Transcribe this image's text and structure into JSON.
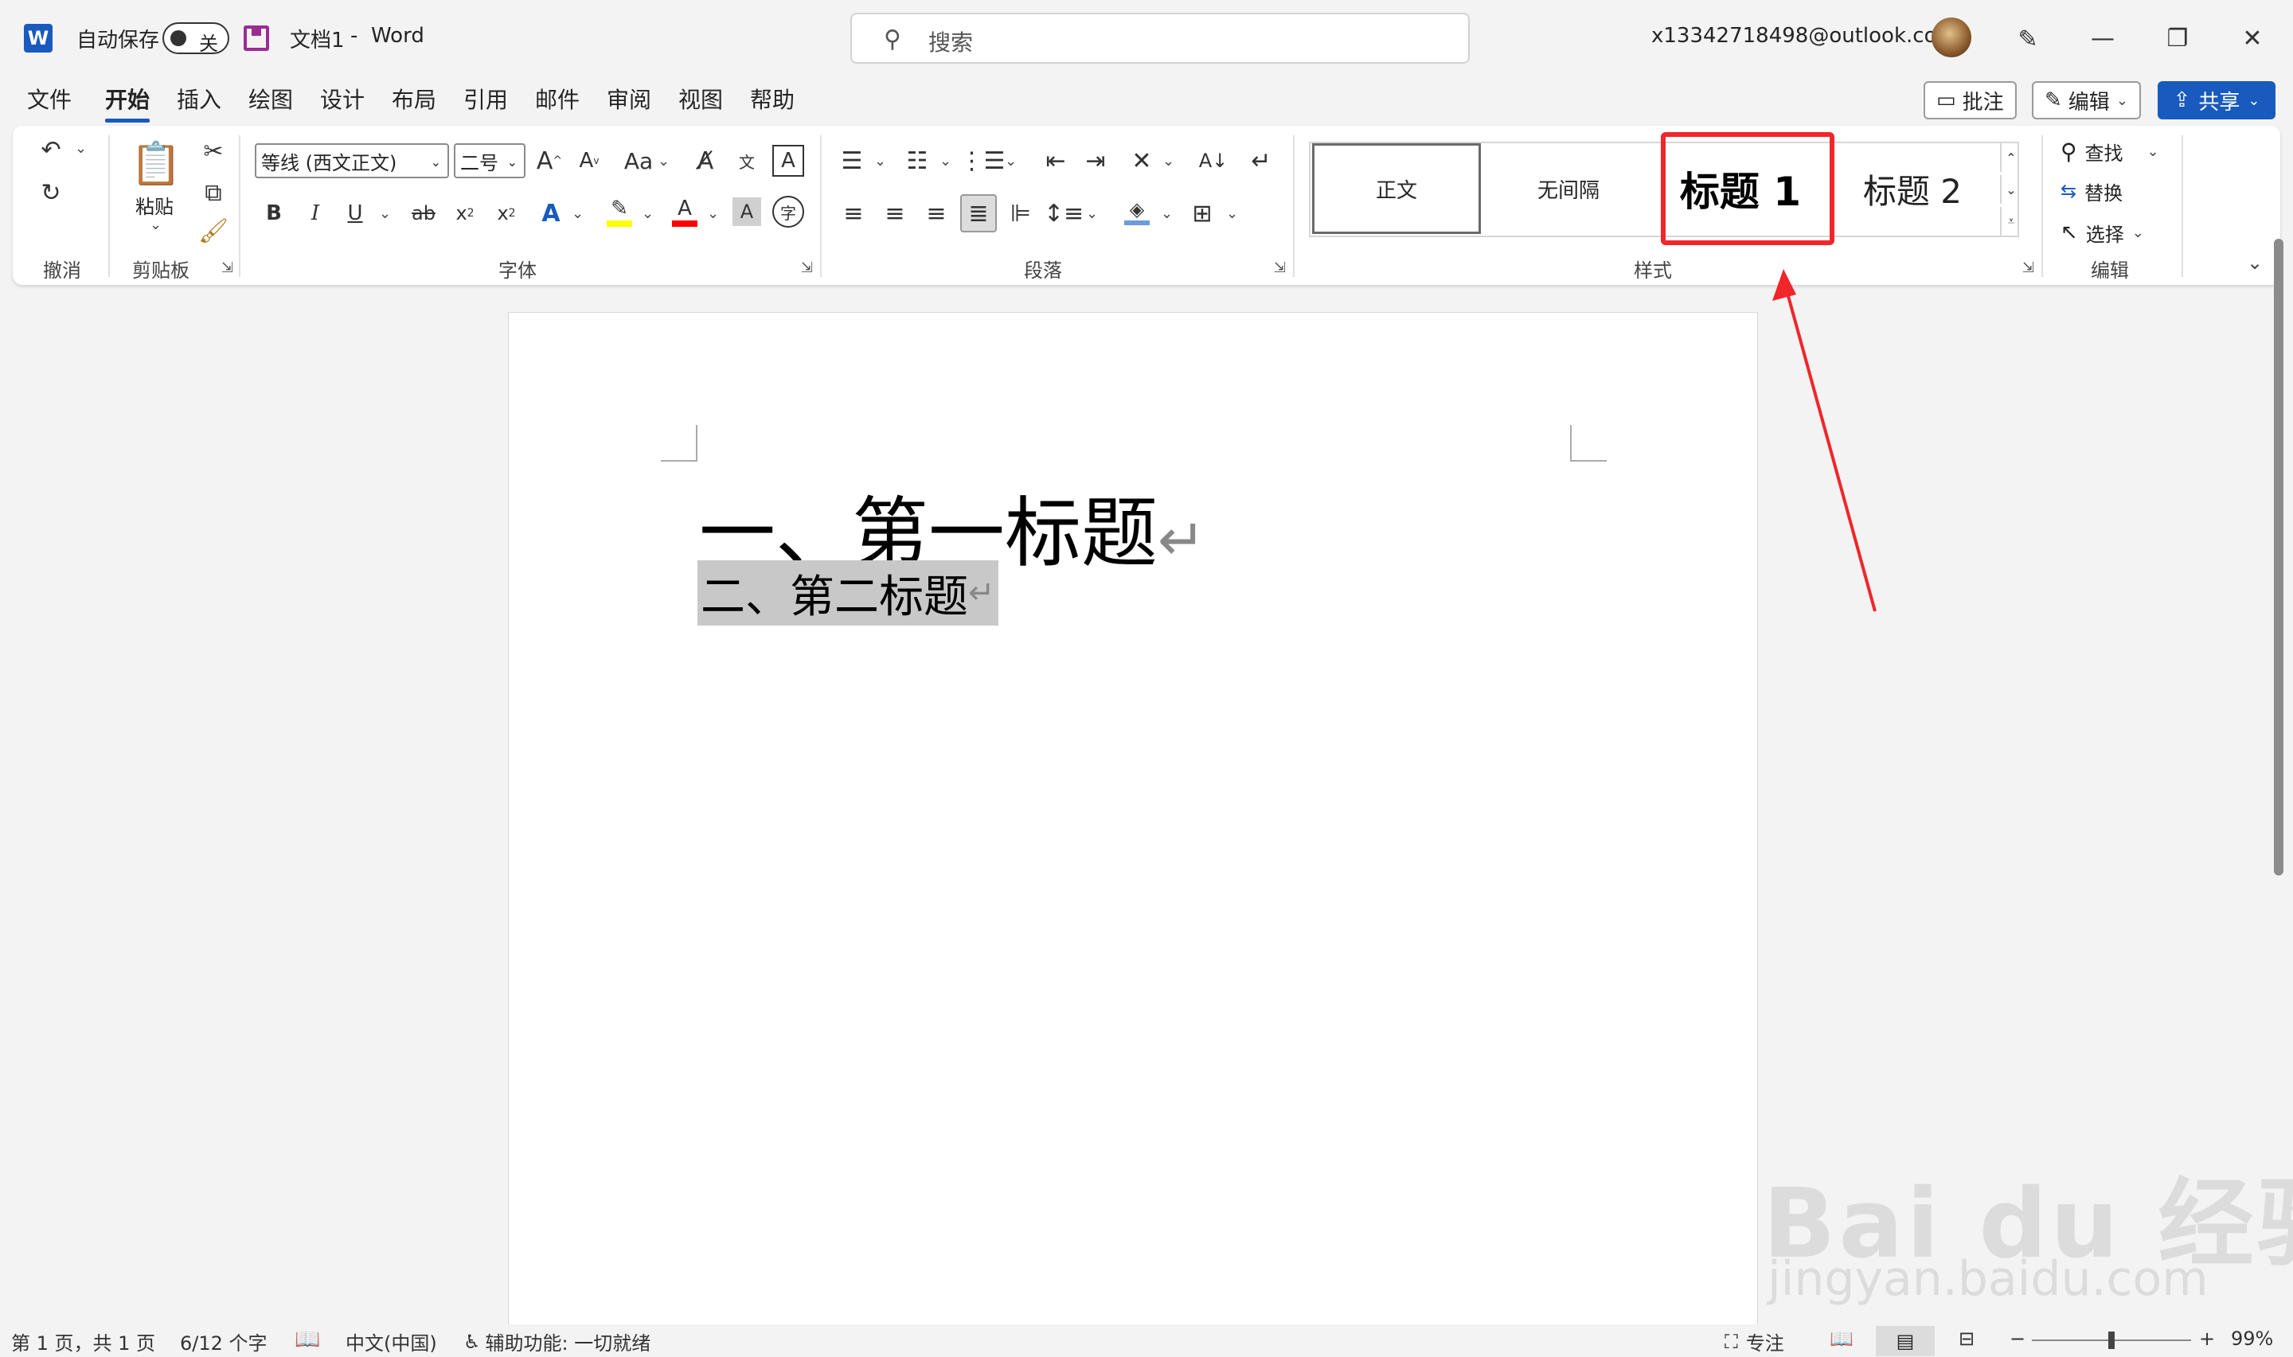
{
  "titlebar": {
    "autosave_label": "自动保存",
    "autosave_state": "关",
    "doc_title": "文档1",
    "separator": "-",
    "app_name": "Word",
    "search_placeholder": "搜索",
    "account": "x13342718498@outlook.com"
  },
  "tabs": [
    "文件",
    "开始",
    "插入",
    "绘图",
    "设计",
    "布局",
    "引用",
    "邮件",
    "审阅",
    "视图",
    "帮助"
  ],
  "topright": {
    "comments": "批注",
    "editing": "编辑",
    "share": "共享"
  },
  "ribbon": {
    "undo_group": "撤消",
    "clipboard_group": "剪贴板",
    "paste": "粘贴",
    "font_group": "字体",
    "font_name": "等线 (西文正文)",
    "font_size": "二号",
    "aa_label": "Aa",
    "paragraph_group": "段落",
    "styles_group": "样式",
    "editing_group": "编辑",
    "styles": [
      "正文",
      "无间隔",
      "标题 1",
      "标题 2"
    ],
    "find": "查找",
    "replace": "替换",
    "select": "选择",
    "colors": {
      "highlight": "#ffff00",
      "font_color": "#ff0000",
      "accent": "#185abd",
      "annotation": "#f0262a"
    }
  },
  "document": {
    "heading1": "一、第一标题",
    "heading2": "二、第二标题",
    "para_mark": "↵"
  },
  "status": {
    "page": "第 1 页，共 1 页",
    "words": "6/12 个字",
    "language": "中文(中国)",
    "accessibility": "辅助功能: 一切就绪",
    "focus": "专注",
    "zoom": "99%",
    "zoom_level": 0.5
  },
  "watermark": {
    "brand": "Bai du 经验",
    "url": "jingyan.baidu.com"
  }
}
